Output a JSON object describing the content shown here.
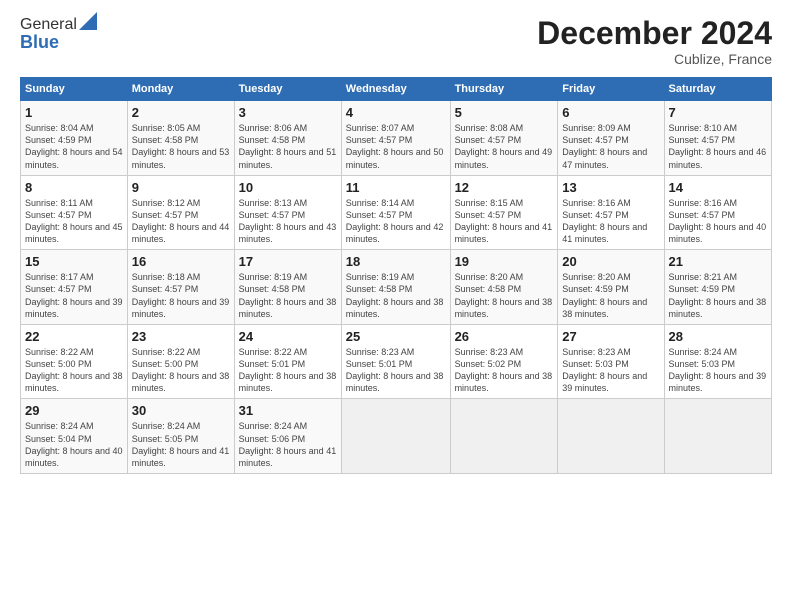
{
  "logo": {
    "line1": "General",
    "line2": "Blue"
  },
  "title": "December 2024",
  "location": "Cublize, France",
  "headers": [
    "Sunday",
    "Monday",
    "Tuesday",
    "Wednesday",
    "Thursday",
    "Friday",
    "Saturday"
  ],
  "weeks": [
    [
      {
        "day": "1",
        "sunrise": "Sunrise: 8:04 AM",
        "sunset": "Sunset: 4:59 PM",
        "daylight": "Daylight: 8 hours and 54 minutes."
      },
      {
        "day": "2",
        "sunrise": "Sunrise: 8:05 AM",
        "sunset": "Sunset: 4:58 PM",
        "daylight": "Daylight: 8 hours and 53 minutes."
      },
      {
        "day": "3",
        "sunrise": "Sunrise: 8:06 AM",
        "sunset": "Sunset: 4:58 PM",
        "daylight": "Daylight: 8 hours and 51 minutes."
      },
      {
        "day": "4",
        "sunrise": "Sunrise: 8:07 AM",
        "sunset": "Sunset: 4:57 PM",
        "daylight": "Daylight: 8 hours and 50 minutes."
      },
      {
        "day": "5",
        "sunrise": "Sunrise: 8:08 AM",
        "sunset": "Sunset: 4:57 PM",
        "daylight": "Daylight: 8 hours and 49 minutes."
      },
      {
        "day": "6",
        "sunrise": "Sunrise: 8:09 AM",
        "sunset": "Sunset: 4:57 PM",
        "daylight": "Daylight: 8 hours and 47 minutes."
      },
      {
        "day": "7",
        "sunrise": "Sunrise: 8:10 AM",
        "sunset": "Sunset: 4:57 PM",
        "daylight": "Daylight: 8 hours and 46 minutes."
      }
    ],
    [
      {
        "day": "8",
        "sunrise": "Sunrise: 8:11 AM",
        "sunset": "Sunset: 4:57 PM",
        "daylight": "Daylight: 8 hours and 45 minutes."
      },
      {
        "day": "9",
        "sunrise": "Sunrise: 8:12 AM",
        "sunset": "Sunset: 4:57 PM",
        "daylight": "Daylight: 8 hours and 44 minutes."
      },
      {
        "day": "10",
        "sunrise": "Sunrise: 8:13 AM",
        "sunset": "Sunset: 4:57 PM",
        "daylight": "Daylight: 8 hours and 43 minutes."
      },
      {
        "day": "11",
        "sunrise": "Sunrise: 8:14 AM",
        "sunset": "Sunset: 4:57 PM",
        "daylight": "Daylight: 8 hours and 42 minutes."
      },
      {
        "day": "12",
        "sunrise": "Sunrise: 8:15 AM",
        "sunset": "Sunset: 4:57 PM",
        "daylight": "Daylight: 8 hours and 41 minutes."
      },
      {
        "day": "13",
        "sunrise": "Sunrise: 8:16 AM",
        "sunset": "Sunset: 4:57 PM",
        "daylight": "Daylight: 8 hours and 41 minutes."
      },
      {
        "day": "14",
        "sunrise": "Sunrise: 8:16 AM",
        "sunset": "Sunset: 4:57 PM",
        "daylight": "Daylight: 8 hours and 40 minutes."
      }
    ],
    [
      {
        "day": "15",
        "sunrise": "Sunrise: 8:17 AM",
        "sunset": "Sunset: 4:57 PM",
        "daylight": "Daylight: 8 hours and 39 minutes."
      },
      {
        "day": "16",
        "sunrise": "Sunrise: 8:18 AM",
        "sunset": "Sunset: 4:57 PM",
        "daylight": "Daylight: 8 hours and 39 minutes."
      },
      {
        "day": "17",
        "sunrise": "Sunrise: 8:19 AM",
        "sunset": "Sunset: 4:58 PM",
        "daylight": "Daylight: 8 hours and 38 minutes."
      },
      {
        "day": "18",
        "sunrise": "Sunrise: 8:19 AM",
        "sunset": "Sunset: 4:58 PM",
        "daylight": "Daylight: 8 hours and 38 minutes."
      },
      {
        "day": "19",
        "sunrise": "Sunrise: 8:20 AM",
        "sunset": "Sunset: 4:58 PM",
        "daylight": "Daylight: 8 hours and 38 minutes."
      },
      {
        "day": "20",
        "sunrise": "Sunrise: 8:20 AM",
        "sunset": "Sunset: 4:59 PM",
        "daylight": "Daylight: 8 hours and 38 minutes."
      },
      {
        "day": "21",
        "sunrise": "Sunrise: 8:21 AM",
        "sunset": "Sunset: 4:59 PM",
        "daylight": "Daylight: 8 hours and 38 minutes."
      }
    ],
    [
      {
        "day": "22",
        "sunrise": "Sunrise: 8:22 AM",
        "sunset": "Sunset: 5:00 PM",
        "daylight": "Daylight: 8 hours and 38 minutes."
      },
      {
        "day": "23",
        "sunrise": "Sunrise: 8:22 AM",
        "sunset": "Sunset: 5:00 PM",
        "daylight": "Daylight: 8 hours and 38 minutes."
      },
      {
        "day": "24",
        "sunrise": "Sunrise: 8:22 AM",
        "sunset": "Sunset: 5:01 PM",
        "daylight": "Daylight: 8 hours and 38 minutes."
      },
      {
        "day": "25",
        "sunrise": "Sunrise: 8:23 AM",
        "sunset": "Sunset: 5:01 PM",
        "daylight": "Daylight: 8 hours and 38 minutes."
      },
      {
        "day": "26",
        "sunrise": "Sunrise: 8:23 AM",
        "sunset": "Sunset: 5:02 PM",
        "daylight": "Daylight: 8 hours and 38 minutes."
      },
      {
        "day": "27",
        "sunrise": "Sunrise: 8:23 AM",
        "sunset": "Sunset: 5:03 PM",
        "daylight": "Daylight: 8 hours and 39 minutes."
      },
      {
        "day": "28",
        "sunrise": "Sunrise: 8:24 AM",
        "sunset": "Sunset: 5:03 PM",
        "daylight": "Daylight: 8 hours and 39 minutes."
      }
    ],
    [
      {
        "day": "29",
        "sunrise": "Sunrise: 8:24 AM",
        "sunset": "Sunset: 5:04 PM",
        "daylight": "Daylight: 8 hours and 40 minutes."
      },
      {
        "day": "30",
        "sunrise": "Sunrise: 8:24 AM",
        "sunset": "Sunset: 5:05 PM",
        "daylight": "Daylight: 8 hours and 41 minutes."
      },
      {
        "day": "31",
        "sunrise": "Sunrise: 8:24 AM",
        "sunset": "Sunset: 5:06 PM",
        "daylight": "Daylight: 8 hours and 41 minutes."
      },
      null,
      null,
      null,
      null
    ]
  ]
}
